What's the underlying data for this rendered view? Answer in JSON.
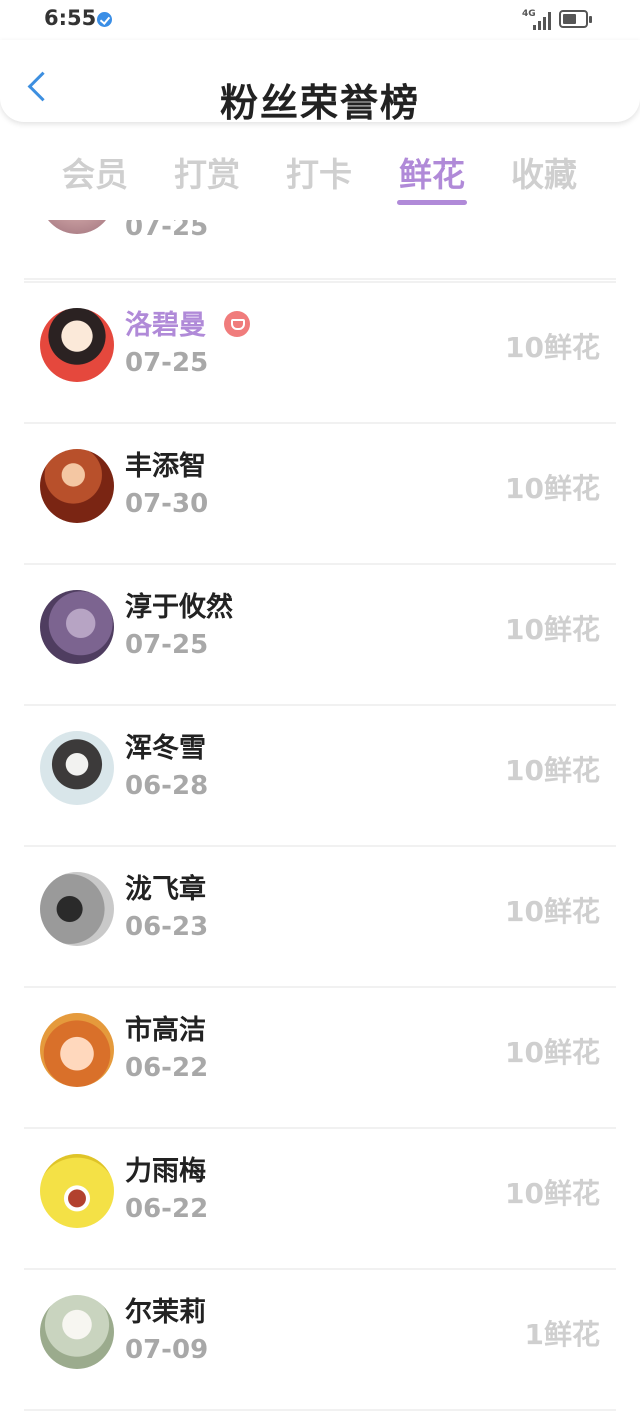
{
  "status_bar": {
    "time": "6:55",
    "network": "4G"
  },
  "header": {
    "title": "粉丝荣誉榜",
    "back_icon": "chevron-left-icon"
  },
  "tabs": [
    {
      "label": "会员",
      "active": false
    },
    {
      "label": "打赏",
      "active": false
    },
    {
      "label": "打卡",
      "active": false
    },
    {
      "label": "鲜花",
      "active": true
    },
    {
      "label": "收藏",
      "active": false
    }
  ],
  "colors": {
    "accent": "#b08ad8",
    "back_icon": "#3d8fe0",
    "vip_badge": "#f07c7c",
    "muted": "#cfcfcf"
  },
  "partial_row": {
    "date": "07-25"
  },
  "fans": [
    {
      "name": "洛碧曼",
      "date": "07-25",
      "amount": "10鲜花",
      "vip": true
    },
    {
      "name": "丰添智",
      "date": "07-30",
      "amount": "10鲜花",
      "vip": false
    },
    {
      "name": "淳于攸然",
      "date": "07-25",
      "amount": "10鲜花",
      "vip": false
    },
    {
      "name": "浑冬雪",
      "date": "06-28",
      "amount": "10鲜花",
      "vip": false
    },
    {
      "name": "泷飞章",
      "date": "06-23",
      "amount": "10鲜花",
      "vip": false
    },
    {
      "name": "市高洁",
      "date": "06-22",
      "amount": "10鲜花",
      "vip": false
    },
    {
      "name": "力雨梅",
      "date": "06-22",
      "amount": "10鲜花",
      "vip": false
    },
    {
      "name": "尔茉莉",
      "date": "07-09",
      "amount": "1鲜花",
      "vip": false
    }
  ]
}
